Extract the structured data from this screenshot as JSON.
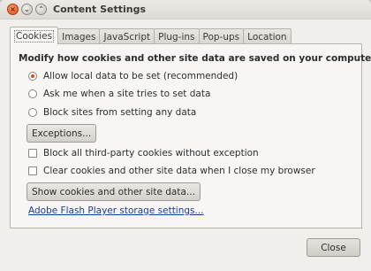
{
  "window": {
    "title": "Content Settings",
    "controls": {
      "close_glyph": "×",
      "minimize_glyph": "⌄",
      "maximize_glyph": "⌃"
    }
  },
  "tabs": [
    {
      "label": "Cookies",
      "active": true
    },
    {
      "label": "Images"
    },
    {
      "label": "JavaScript"
    },
    {
      "label": "Plug-ins"
    },
    {
      "label": "Pop-ups"
    },
    {
      "label": "Location"
    }
  ],
  "cookies": {
    "heading": "Modify how cookies and other site data are saved on your computer",
    "radios": [
      {
        "label": "Allow local data to be set (recommended)",
        "selected": true
      },
      {
        "label": "Ask me when a site tries to set data",
        "selected": false
      },
      {
        "label": "Block sites from setting any data",
        "selected": false
      }
    ],
    "exceptions_button": "Exceptions...",
    "checkboxes": [
      {
        "label": "Block all third-party cookies without exception",
        "checked": false
      },
      {
        "label": "Clear cookies and other site data when I close my browser",
        "checked": false
      }
    ],
    "show_button": "Show cookies and other site data...",
    "flash_link": "Adobe Flash Player storage settings..."
  },
  "footer": {
    "close_button": "Close"
  },
  "colors": {
    "accent_radio": "#df4a16",
    "link": "#1b3c9e"
  }
}
